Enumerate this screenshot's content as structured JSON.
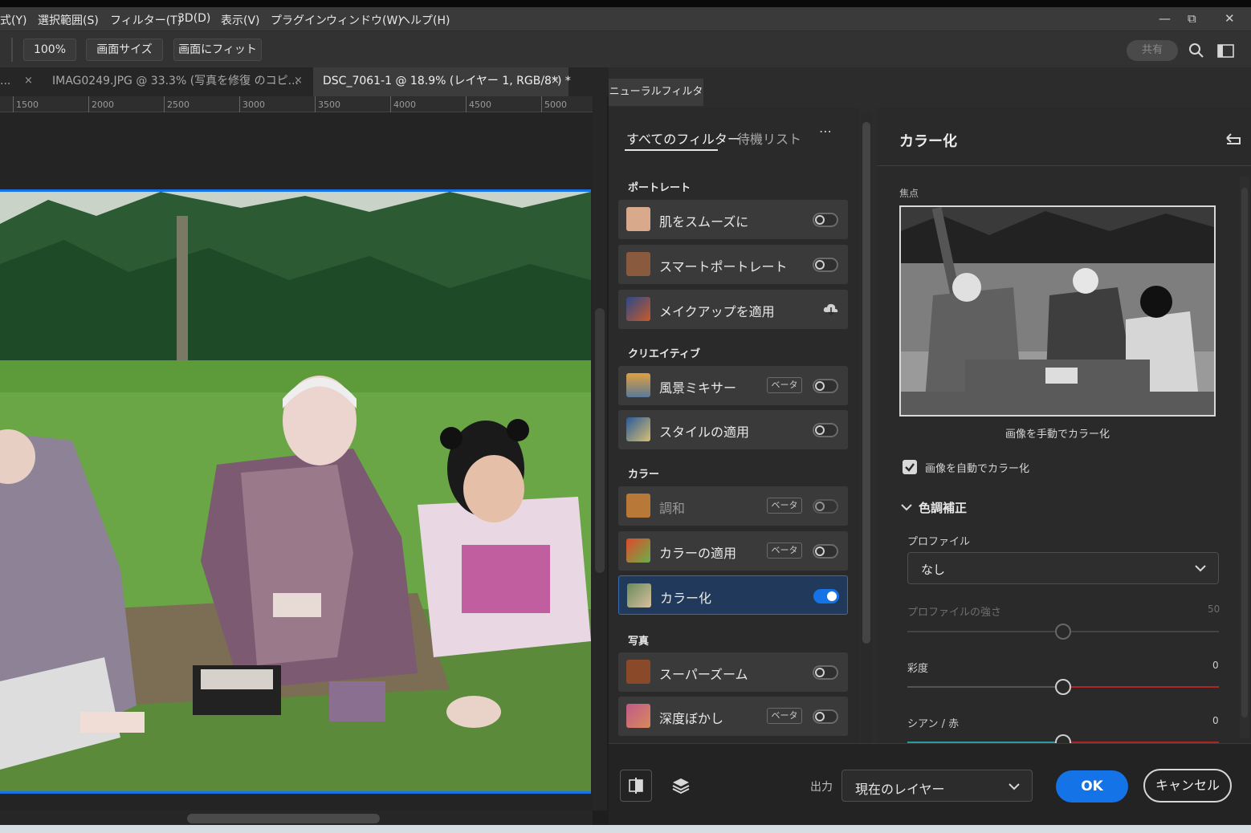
{
  "menu": [
    "式(Y)",
    "選択範囲(S)",
    "フィルター(T)",
    "3D(D)",
    "表示(V)",
    "プラグイン",
    "ウィンドウ(W)",
    "ヘルプ(H)"
  ],
  "window_controls": {
    "minimize": "—",
    "restore": "⧉",
    "close": "✕"
  },
  "options": {
    "zoom": "100%",
    "fit_size": "画面サイズ",
    "fit_screen": "画面にフィット",
    "share": "共有"
  },
  "doc_tabs": [
    {
      "label": "...",
      "close": "×"
    },
    {
      "label": "IMAG0249.JPG @ 33.3% (写真を修復 のコピ...",
      "close": "×"
    },
    {
      "label": "DSC_7061-1 @ 18.9% (レイヤー 1, RGB/8*) *",
      "close": "×"
    }
  ],
  "ruler_ticks": [
    "1500",
    "2000",
    "2500",
    "3000",
    "3500",
    "4000",
    "4500",
    "5000"
  ],
  "neural": {
    "panel_tab": "ニューラルフィルター",
    "tabs": {
      "all": "すべてのフィルター",
      "waitlist": "待機リスト",
      "more": "⋯"
    },
    "categories": {
      "portrait": "ポートレート",
      "creative": "クリエイティブ",
      "color": "カラー",
      "photo": "写真"
    },
    "beta": "ベータ",
    "filters": {
      "skin": "肌をスムーズに",
      "smart": "スマートポートレート",
      "makeup": "メイクアップを適用",
      "landscape": "風景ミキサー",
      "style": "スタイルの適用",
      "harmony": "調和",
      "colortransfer": "カラーの適用",
      "colorize": "カラー化",
      "superzoom": "スーパーズーム",
      "depthblur": "深度ぼかし"
    },
    "toggles": {
      "skin": false,
      "smart": false,
      "landscape": false,
      "style": false,
      "harmony": false,
      "colortransfer": false,
      "colorize": true,
      "superzoom": false,
      "depthblur": false
    }
  },
  "detail": {
    "title": "カラー化",
    "focus_label": "焦点",
    "manual_caption": "画像を手動でカラー化",
    "auto_colorize": {
      "label": "画像を自動でカラー化",
      "checked": true
    },
    "section": "色調補正",
    "profile_label": "プロファイル",
    "profile_value": "なし",
    "sliders": [
      {
        "label": "プロファイルの強さ",
        "value": "50",
        "disabled": true
      },
      {
        "label": "彩度",
        "value": "0"
      },
      {
        "label": "シアン / 赤",
        "value": "0"
      }
    ]
  },
  "footer": {
    "output_label": "出力",
    "output_value": "現在のレイヤー",
    "ok": "OK",
    "cancel": "キャンセル"
  },
  "colors": {
    "accent": "#1473e6",
    "panel": "#2c2c2c",
    "selected_row": "#213a5c"
  }
}
